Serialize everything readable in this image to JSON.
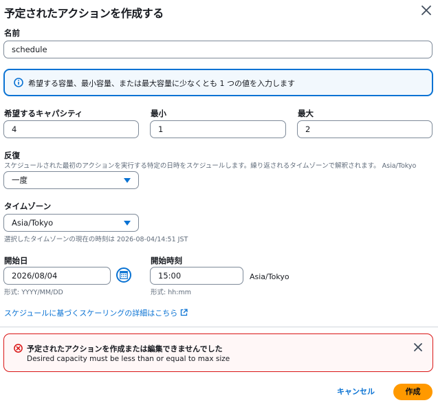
{
  "dialog": {
    "title": "予定されたアクションを作成する"
  },
  "name_field": {
    "label": "名前",
    "value": "schedule"
  },
  "info": {
    "text": "希望する容量、最小容量、または最大容量に少なくとも 1 つの値を入力します"
  },
  "capacity": {
    "desired_label": "希望するキャパシティ",
    "desired_value": "4",
    "min_label": "最小",
    "min_value": "1",
    "max_label": "最大",
    "max_value": "2"
  },
  "recurrence": {
    "label": "反復",
    "description": "スケジュールされた最初のアクションを実行する特定の日時をスケジュールします。繰り返されるタイムゾーンで解釈されます。 Asia/Tokyo",
    "selected": "一度"
  },
  "timezone": {
    "label": "タイムゾーン",
    "selected": "Asia/Tokyo",
    "current_time_note": "選択したタイムゾーンの現在の時刻は 2026-08-04/14:51 JST"
  },
  "start_date": {
    "label": "開始日",
    "value": "2026/08/04",
    "format_hint": "形式: YYYY/MM/DD"
  },
  "start_time": {
    "label": "開始時刻",
    "value": "15:00",
    "format_hint": "形式: hh:mm",
    "timezone_suffix": "Asia/Tokyo"
  },
  "learn_more_link": "スケジュールに基づくスケーリングの詳細はこちら",
  "error": {
    "title": "予定されたアクションを作成または編集できませんでした",
    "message": "Desired capacity must be less than or equal to max size"
  },
  "footer": {
    "cancel_label": "キャンセル",
    "create_label": "作成"
  },
  "colors": {
    "accent": "#0972d3",
    "error": "#d91515",
    "primary_button": "#ff9900"
  }
}
